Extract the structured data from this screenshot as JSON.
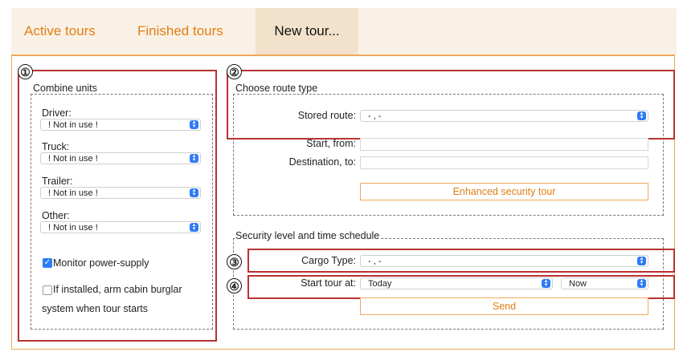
{
  "tabs": {
    "active": "Active tours",
    "finished": "Finished tours",
    "new": "New tour..."
  },
  "markers": [
    "①",
    "②",
    "③",
    "④"
  ],
  "combine": {
    "legend": "Combine units",
    "driver_label": "Driver:",
    "driver_value": "! Not in use !",
    "truck_label": "Truck:",
    "truck_value": "! Not in use !",
    "trailer_label": "Trailer:",
    "trailer_value": "! Not in use !",
    "other_label": "Other:",
    "other_value": "! Not in use !",
    "monitor_label": "Monitor power-supply",
    "monitor_checked": true,
    "burglar_label_1": "If installed, arm cabin burglar",
    "burglar_label_2": "system when tour starts",
    "burglar_checked": false
  },
  "route": {
    "legend": "Choose route type",
    "stored_label": "Stored route:",
    "stored_value": "- , -",
    "start_label": "Start, from:",
    "start_value": "",
    "dest_label": "Destination, to:",
    "dest_value": "",
    "enhanced_button": "Enhanced security tour"
  },
  "security": {
    "legend": "Security level and time schedule",
    "cargo_label": "Cargo Type:",
    "cargo_value": "- , -",
    "start_label": "Start tour at:",
    "day_value": "Today",
    "time_value": "Now",
    "send_button": "Send"
  },
  "colors": {
    "accent": "#e07e14",
    "highlight": "#b83232",
    "select_caret": "#2d7cf5"
  }
}
